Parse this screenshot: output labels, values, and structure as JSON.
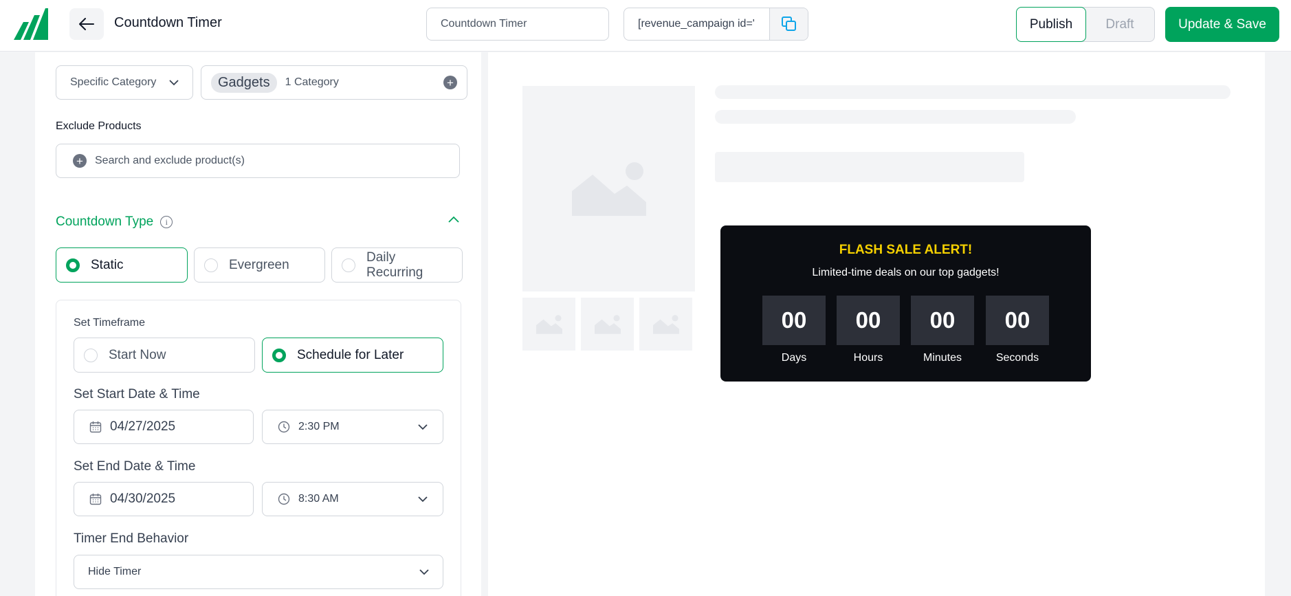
{
  "header": {
    "title": "Countdown Timer",
    "name_value": "Countdown Timer",
    "shortcode": "[revenue_campaign id='",
    "status_options": [
      "Publish",
      "Draft"
    ],
    "status_selected": "Publish",
    "save_label": "Update & Save"
  },
  "targeting": {
    "category_select": "Specific Category",
    "category_chip": "Gadgets",
    "category_count": "1 Category",
    "exclude_label": "Exclude Products",
    "exclude_placeholder": "Search and exclude product(s)"
  },
  "countdown": {
    "section_title": "Countdown Type",
    "types": [
      "Static",
      "Evergreen",
      "Daily Recurring"
    ],
    "type_selected": "Static",
    "timeframe_label": "Set Timeframe",
    "timeframe_options": [
      "Start Now",
      "Schedule for Later"
    ],
    "timeframe_selected": "Schedule for Later",
    "start_label": "Set Start Date & Time",
    "start_date": "04/27/2025",
    "start_time": "2:30 PM",
    "end_label": "Set End Date & Time",
    "end_date": "04/30/2025",
    "end_time": "8:30 AM",
    "end_behavior_label": "Timer End Behavior",
    "end_behavior": "Hide Timer"
  },
  "preview": {
    "title": "FLASH SALE ALERT!",
    "subtitle": "Limited-time deals on our top gadgets!",
    "units": [
      {
        "value": "00",
        "label": "Days"
      },
      {
        "value": "00",
        "label": "Hours"
      },
      {
        "value": "00",
        "label": "Minutes"
      },
      {
        "value": "00",
        "label": "Seconds"
      }
    ]
  },
  "colors": {
    "accent": "#00a35c",
    "timer_bg": "#0b0d12",
    "timer_title": "#f5d000",
    "timer_box": "#2d3039"
  }
}
